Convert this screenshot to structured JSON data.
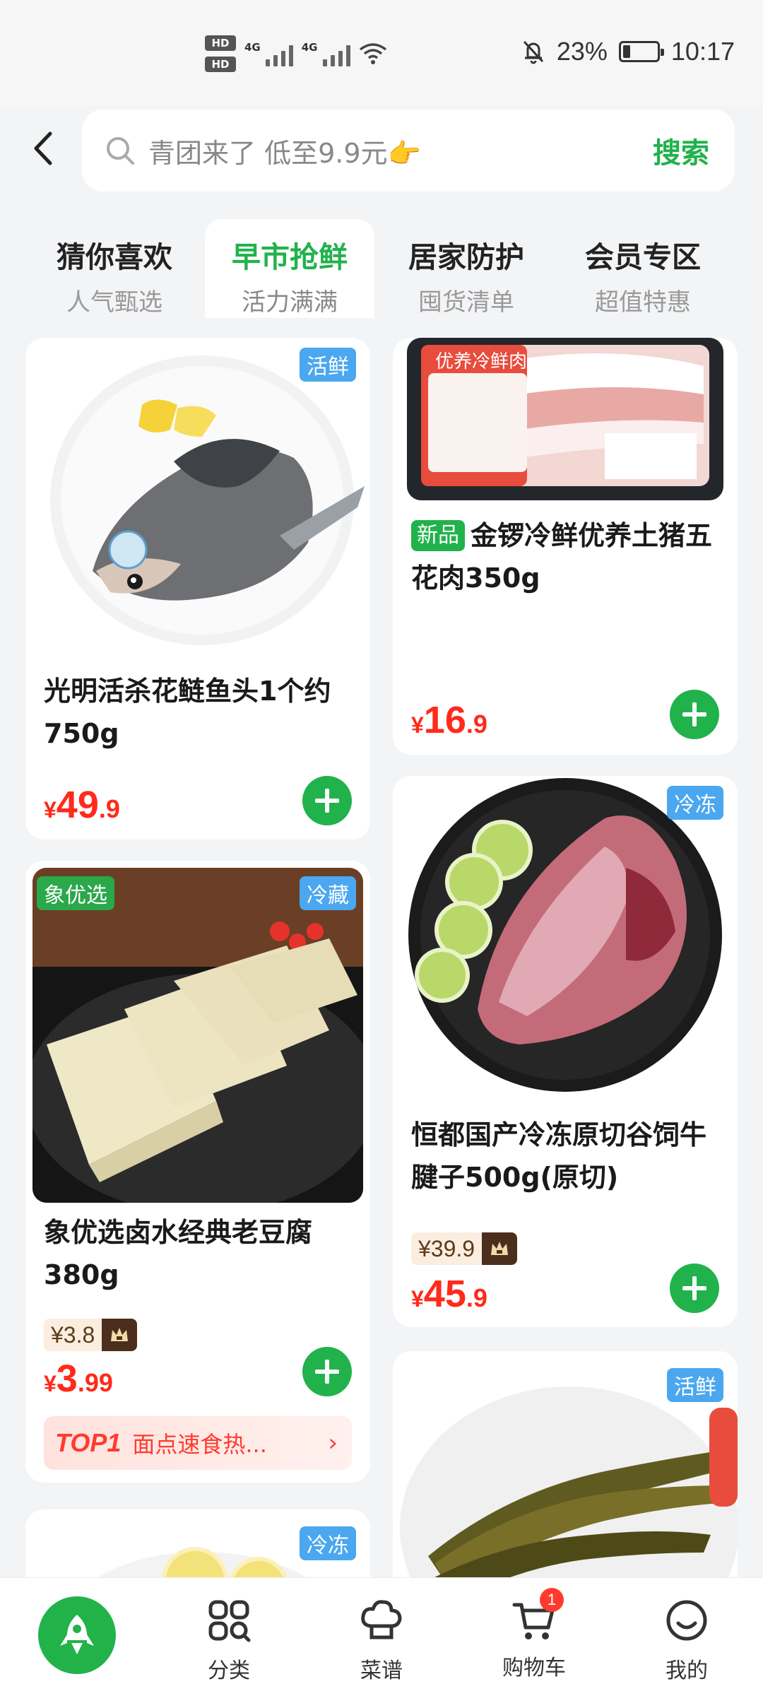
{
  "status_bar": {
    "hd1": "HD",
    "hd2": "HD",
    "sig1": "4G",
    "sig2": "4G",
    "battery_pct": "23%",
    "battery_level": 0.23,
    "time": "10:17"
  },
  "search": {
    "placeholder": "青团来了 低至9.9元👉",
    "button": "搜索"
  },
  "tabs": [
    {
      "title": "猜你喜欢",
      "subtitle": "人气甄选"
    },
    {
      "title": "早市抢鲜",
      "subtitle": "活力满满"
    },
    {
      "title": "居家防护",
      "subtitle": "囤货清单"
    },
    {
      "title": "会员专区",
      "subtitle": "超值特惠"
    }
  ],
  "products": {
    "fish_head": {
      "badge": "活鲜",
      "name": "光明活杀花鲢鱼头1个约750g",
      "currency": "¥",
      "price_int": "49",
      "price_dec": ".9"
    },
    "pork_belly": {
      "new_tag": "新品",
      "name": "金锣冷鲜优养土猪五花肉350g",
      "currency": "¥",
      "price_int": "16",
      "price_dec": ".9",
      "package_text": "优养冷鲜肉"
    },
    "tofu": {
      "brand_badge": "象优选",
      "badge": "冷藏",
      "name": "象优选卤水经典老豆腐380g",
      "member_price": "¥3.8",
      "currency": "¥",
      "price_int": "3",
      "price_dec": ".99",
      "rank_label": "TOP1",
      "rank_text": "面点速食热...",
      "rank_arrow": "›"
    },
    "beef_shank": {
      "badge": "冷冻",
      "name": "恒都国产冷冻原切谷饲牛腱子500g(原切)",
      "member_price": "¥39.9",
      "currency": "¥",
      "price_int": "45",
      "price_dec": ".9"
    },
    "catfish": {
      "badge": "活鲜"
    },
    "lemon_item": {
      "badge": "冷冻"
    }
  },
  "bottom_nav": {
    "home_icon": "rocket-icon",
    "items": [
      {
        "label": "分类",
        "icon": "category-icon"
      },
      {
        "label": "菜谱",
        "icon": "chef-hat-icon"
      },
      {
        "label": "购物车",
        "icon": "cart-icon",
        "badge": "1"
      },
      {
        "label": "我的",
        "icon": "smiley-icon"
      }
    ]
  },
  "colors": {
    "accent": "#21b24c",
    "price": "#ff2a1a",
    "badge_blue": "#4aa7f0",
    "background": "#f3f4f6"
  }
}
